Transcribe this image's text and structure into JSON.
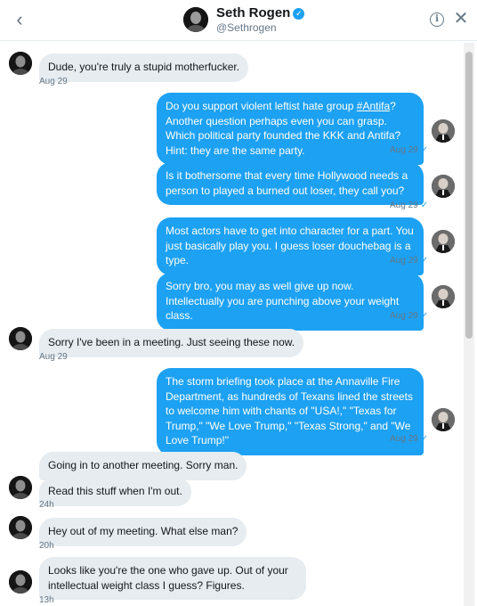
{
  "header": {
    "back_icon": "chevron-left-icon",
    "name": "Seth Rogen",
    "handle": "@Sethrogen",
    "verified_icon": "verified-badge-icon",
    "info_icon": "info-icon",
    "close_icon": "close-icon"
  },
  "colors": {
    "accent": "#1da1f2",
    "incoming_bubble": "#e6ecf0",
    "muted_text": "#657786"
  },
  "messages": [
    {
      "sender": "seth",
      "text": "Dude, you're truly a stupid motherfucker.",
      "time": "Aug 29"
    },
    {
      "sender": "other",
      "text_before": "Do you support violent leftist hate group ",
      "link": "#Antifa",
      "text_after": "? Another question perhaps even you can grasp.  Which political party founded the KKK and Antifa?  Hint: they are the same party.",
      "time": "Aug 29"
    },
    {
      "sender": "other",
      "text": "Is it bothersome that every time Hollywood needs a person to played a burned out loser, they call you?",
      "time": "Aug 29"
    },
    {
      "sender": "other",
      "text": "Most actors have to get into character for a part.  You just basically play you.  I guess loser douchebag is a type.",
      "time": "Aug 29"
    },
    {
      "sender": "other",
      "text": "Sorry bro, you may as well give up now.  Intellectually you are punching above your weight class.",
      "time": "Aug 29"
    },
    {
      "sender": "seth",
      "text": "Sorry I've been in a meeting. Just seeing these now.",
      "time": "Aug 29"
    },
    {
      "sender": "other",
      "text": "The storm briefing took place at the Annaville Fire Department, as hundreds of Texans lined the streets to welcome him with chants of \"USA!,\" \"Texas for Trump,\" \"We Love Trump,\" \"Texas Strong,\" and \"We Love Trump!\"",
      "time": "Aug 29"
    },
    {
      "sender": "seth",
      "text": "Going in to another meeting. Sorry man.",
      "time": ""
    },
    {
      "sender": "seth",
      "text": "Read this stuff when I'm out.",
      "time": "24h"
    },
    {
      "sender": "seth",
      "text": "Hey out of my meeting. What else man?",
      "time": "20h"
    },
    {
      "sender": "seth",
      "text": "Looks like you're the one who gave up. Out of your intellectual weight class I guess? Figures.",
      "time": "13h"
    }
  ],
  "read_receipt_icon": "checkmark-icon",
  "read_mark": "✓"
}
